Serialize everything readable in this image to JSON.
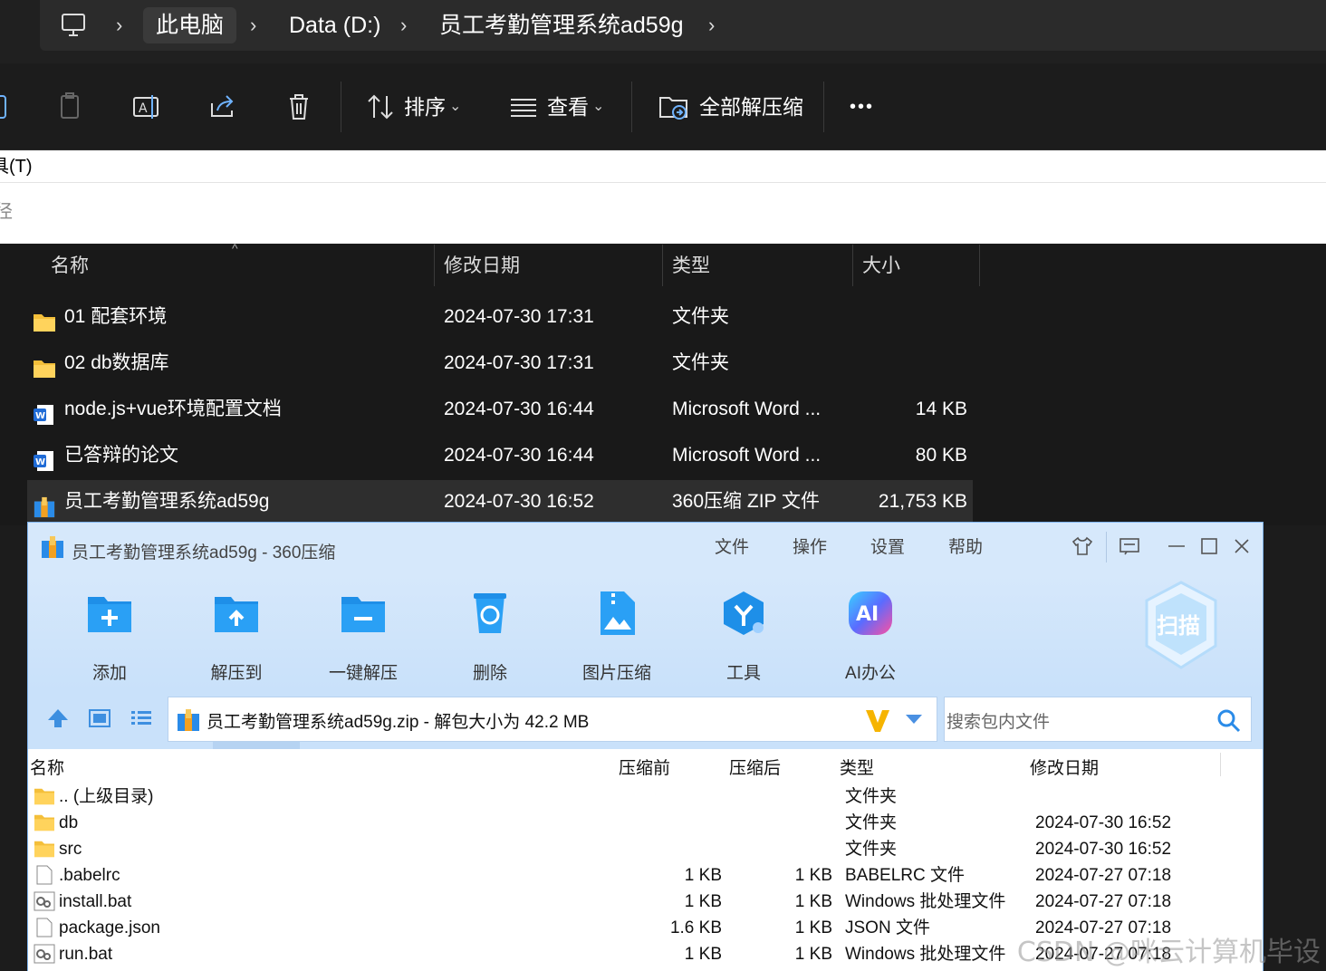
{
  "explorer": {
    "breadcrumb": [
      "此电脑",
      "Data (D:)",
      "员工考勤管理系统ad59g"
    ],
    "toolbar": {
      "sort": "排序",
      "view": "查看",
      "extract_all": "全部解压缩",
      "more": "•••"
    },
    "partial_text_1": "具(T)",
    "partial_text_2": "径",
    "columns": [
      "名称",
      "修改日期",
      "类型",
      "大小"
    ],
    "files": [
      {
        "name": "01 配套环境",
        "date": "2024-07-30 17:31",
        "type": "文件夹",
        "size": "",
        "icon": "folder-icon"
      },
      {
        "name": "02 db数据库",
        "date": "2024-07-30 17:31",
        "type": "文件夹",
        "size": "",
        "icon": "folder-icon"
      },
      {
        "name": "node.js+vue环境配置文档",
        "date": "2024-07-30 16:44",
        "type": "Microsoft Word ...",
        "size": "14 KB",
        "icon": "word-icon"
      },
      {
        "name": "已答辩的论文",
        "date": "2024-07-30 16:44",
        "type": "Microsoft Word ...",
        "size": "80 KB",
        "icon": "word-icon"
      },
      {
        "name": "员工考勤管理系统ad59g",
        "date": "2024-07-30 16:52",
        "type": "360压缩 ZIP 文件",
        "size": "21,753 KB",
        "icon": "zip-icon"
      }
    ]
  },
  "zip360": {
    "title": "员工考勤管理系统ad59g - 360压缩",
    "menu": [
      "文件",
      "操作",
      "设置",
      "帮助"
    ],
    "ribbon": [
      "添加",
      "解压到",
      "一键解压",
      "删除",
      "图片压缩",
      "工具",
      "AI办公"
    ],
    "scan": "扫描",
    "ai_badge": "AI",
    "path": "员工考勤管理系统ad59g.zip - 解包大小为 42.2 MB",
    "search_placeholder": "搜索包内文件",
    "columns": [
      "名称",
      "压缩前",
      "压缩后",
      "类型",
      "修改日期"
    ],
    "rows": [
      {
        "name": ".. (上级目录)",
        "before": "",
        "after": "",
        "type": "文件夹",
        "date": "",
        "icon": "folder-icon"
      },
      {
        "name": "db",
        "before": "",
        "after": "",
        "type": "文件夹",
        "date": "2024-07-30 16:52",
        "icon": "folder-icon"
      },
      {
        "name": "src",
        "before": "",
        "after": "",
        "type": "文件夹",
        "date": "2024-07-30 16:52",
        "icon": "folder-icon"
      },
      {
        "name": ".babelrc",
        "before": "1 KB",
        "after": "1 KB",
        "type": "BABELRC 文件",
        "date": "2024-07-27 07:18",
        "icon": "file-icon"
      },
      {
        "name": "install.bat",
        "before": "1 KB",
        "after": "1 KB",
        "type": "Windows 批处理文件",
        "date": "2024-07-27 07:18",
        "icon": "bat-icon"
      },
      {
        "name": "package.json",
        "before": "1.6 KB",
        "after": "1 KB",
        "type": "JSON 文件",
        "date": "2024-07-27 07:18",
        "icon": "file-icon"
      },
      {
        "name": "run.bat",
        "before": "1 KB",
        "after": "1 KB",
        "type": "Windows 批处理文件",
        "date": "2024-07-27 07:18",
        "icon": "bat-icon"
      }
    ]
  },
  "watermark": "CSDN @咪云计算机毕设"
}
